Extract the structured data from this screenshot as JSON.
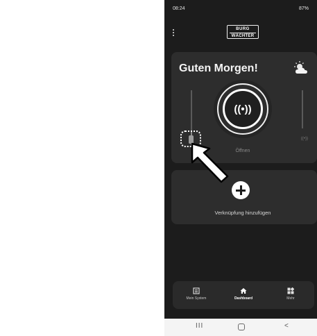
{
  "status_bar": {
    "time": "08:24",
    "right": "87%"
  },
  "brand": {
    "line1": "BURG",
    "line2": "WÄCHTER"
  },
  "greeting_card": {
    "title": "Guten Morgen!",
    "open_label": "Öffnen",
    "mini_signal": "((•))",
    "open_icon": "((•))"
  },
  "shortcut_card": {
    "label": "Verknüpfung hinzufügen"
  },
  "bottom_nav": {
    "items": [
      {
        "label": "Mein System",
        "icon": "list-icon"
      },
      {
        "label": "Dashboard",
        "icon": "home-icon"
      },
      {
        "label": "Mehr",
        "icon": "grid-icon"
      }
    ],
    "active_index": 1
  },
  "system_nav": {
    "recent": "III",
    "back": "<"
  },
  "colors": {
    "background": "#1c1c1c",
    "card": "#2d2d2d",
    "text": "#ffffff"
  }
}
